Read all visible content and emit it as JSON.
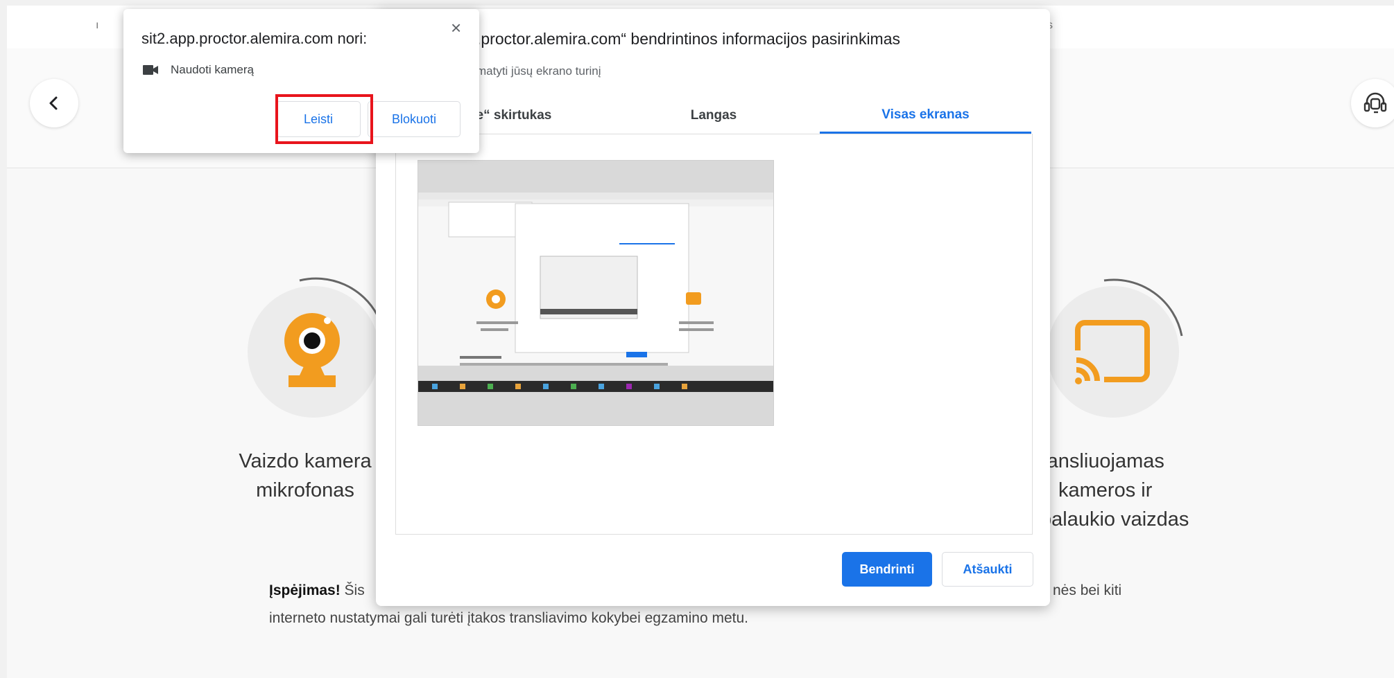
{
  "topbar": {
    "frag_left": "ı",
    "frag_right": "s"
  },
  "steps": [
    {
      "line1": "Vaizdo kamera",
      "line2": "mikrofonas"
    },
    {
      "line1": "ransliuojamas",
      "line2": "kameros ir",
      "line3": "palaukio vaizdas"
    }
  ],
  "warning": {
    "bold": "Įspėjimas!",
    "line1_start": " Šis",
    "line1_end": "nės bei kiti",
    "line2": "interneto nustatymai gali turėti įtakos transliavimo kokybei egzamino metu."
  },
  "share_dialog": {
    "title": ".proctor.alemira.com“ bendrintinos informacijos pasirinkimas",
    "subtitle": "matyti jūsų ekrano turinį",
    "tabs": [
      {
        "label": "rome“ skirtukas"
      },
      {
        "label": "Langas"
      },
      {
        "label": "Visas ekranas"
      }
    ],
    "active_tab": "Visas ekranas",
    "share_button": "Bendrinti",
    "cancel_button": "Atšaukti"
  },
  "permission": {
    "title": "sit2.app.proctor.alemira.com nori:",
    "item": "Naudoti kamerą",
    "allow": "Leisti",
    "block": "Blokuoti",
    "close": "×"
  },
  "colors": {
    "accent": "#1a73e8",
    "highlight": "#e8141c",
    "webcam_orange": "#f29c1f",
    "cast_orange": "#f29c1f"
  }
}
